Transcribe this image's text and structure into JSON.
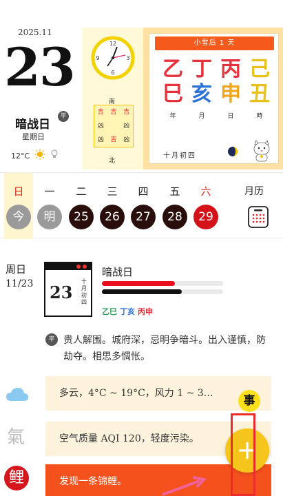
{
  "header": {
    "year_month": "2025.11",
    "day_number": "23",
    "day_name": "暗战日",
    "day_badge": "平",
    "weekday": "星期日",
    "temperature": "12°C"
  },
  "clock": {
    "n12": "12",
    "n3": "3",
    "n6": "6",
    "n9": "9"
  },
  "compass": {
    "south": "南",
    "north": "北",
    "grid": [
      "吉",
      "吉",
      "吉",
      "凶",
      "",
      "凶",
      "凶",
      "吉",
      "凶"
    ]
  },
  "almanac": {
    "jieqi_banner": "小雪后 1 天",
    "pillars": [
      {
        "stem": "乙",
        "branch": "巳",
        "label": "年",
        "stem_color": "#e6323c",
        "branch_color": "#e6323c"
      },
      {
        "stem": "丁",
        "branch": "亥",
        "label": "月",
        "stem_color": "#e6323c",
        "branch_color": "#2a72d8"
      },
      {
        "stem": "丙",
        "branch": "申",
        "label": "日",
        "stem_color": "#e6323c",
        "branch_color": "#f0a51c"
      },
      {
        "stem": "己",
        "branch": "丑",
        "label": "時",
        "stem_color": "#e8c21a",
        "branch_color": "#e8c21a"
      }
    ],
    "lunar_date": "十月初四"
  },
  "week": {
    "weekdays": [
      "日",
      "一",
      "二",
      "三",
      "四",
      "五",
      "六"
    ],
    "dates": [
      "今",
      "明",
      "25",
      "26",
      "27",
      "28",
      "29"
    ],
    "calendar_label": "月历"
  },
  "detail": {
    "weekday": "周日",
    "date": "11/23",
    "mini_day": "23",
    "mini_lunar": "十月初四",
    "title": "暗战日",
    "bar1_pct": 0.6,
    "bar2_pct": 0.66,
    "small_pillars": [
      {
        "text": "乙巳",
        "color": "#2aa15a"
      },
      {
        "text": "丁亥",
        "color": "#2a72d8"
      },
      {
        "text": "丙申",
        "color": "#e6323c"
      }
    ],
    "badge": "平",
    "description": "贵人解围。城府深，忌明争暗斗。出入谨慎，防劫夺。相思多惆怅。"
  },
  "cards": {
    "weather": "多云，4°C ~ 19°C，风力 1 ~ 3…",
    "air": "空气质量 AQI 120，轻度污染。",
    "koi": "发现一条锦鲤。",
    "qi_icon": "氣",
    "koi_icon": "鲤",
    "shi_badge": "事",
    "fab": "+"
  },
  "colors": {
    "accent_orange": "#f5511c",
    "accent_yellow": "#f6c51c",
    "date_dark": "#2a0e0c",
    "date_red": "#d3121a",
    "highlight": "#ea2b2b"
  }
}
